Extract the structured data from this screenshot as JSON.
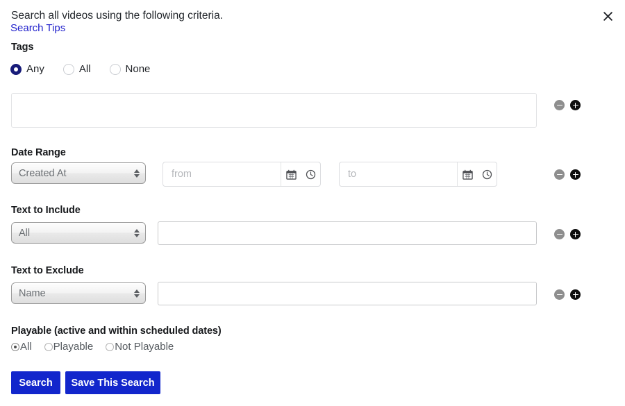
{
  "header": {
    "intro": "Search all videos using the following criteria.",
    "tips_link": "Search Tips",
    "close_icon": "close-x-icon"
  },
  "tags": {
    "label": "Tags",
    "match_options": [
      {
        "label": "Any",
        "selected": true
      },
      {
        "label": "All",
        "selected": false
      },
      {
        "label": "None",
        "selected": false
      }
    ],
    "value": "",
    "remove_icon": "minus-circle-icon",
    "add_icon": "plus-circle-icon"
  },
  "date_range": {
    "label": "Date Range",
    "field_select": "Created At",
    "from": {
      "value": "",
      "placeholder": "from"
    },
    "to": {
      "value": "",
      "placeholder": "to"
    },
    "calendar_icon": "calendar-icon",
    "clock_icon": "clock-icon",
    "remove_icon": "minus-circle-icon",
    "add_icon": "plus-circle-icon"
  },
  "text_include": {
    "label": "Text to Include",
    "field_select": "All",
    "value": "",
    "remove_icon": "minus-circle-icon",
    "add_icon": "plus-circle-icon"
  },
  "text_exclude": {
    "label": "Text to Exclude",
    "field_select": "Name",
    "value": "",
    "remove_icon": "minus-circle-icon",
    "add_icon": "plus-circle-icon"
  },
  "playable": {
    "label": "Playable (active and within scheduled dates)",
    "options": [
      {
        "label": "All",
        "selected": true
      },
      {
        "label": "Playable",
        "selected": false
      },
      {
        "label": "Not Playable",
        "selected": false
      }
    ]
  },
  "actions": {
    "search": "Search",
    "save": "Save This Search"
  },
  "colors": {
    "link": "#2222cc",
    "button": "#1226cc",
    "radio_selected": "#181c7a",
    "add_button": "#0d0d0d",
    "remove_button": "#8e8e8e"
  }
}
